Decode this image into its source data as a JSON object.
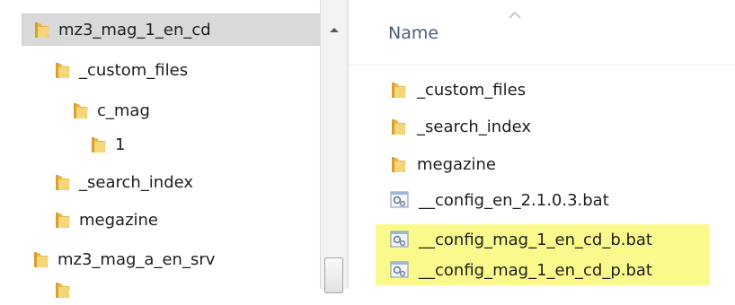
{
  "navigation_pane": {
    "items": [
      {
        "label": "mz3_mag_1_en_cd",
        "icon": "folder-icon",
        "selected": true
      },
      {
        "label": "_custom_files",
        "icon": "folder-icon"
      },
      {
        "label": "c_mag",
        "icon": "folder-icon"
      },
      {
        "label": "1",
        "icon": "folder-icon"
      },
      {
        "label": "_search_index",
        "icon": "folder-icon"
      },
      {
        "label": "megazine",
        "icon": "folder-icon"
      },
      {
        "label": "mz3_mag_a_en_srv",
        "icon": "folder-icon"
      },
      {
        "label": "",
        "icon": "folder-icon"
      }
    ],
    "scrollbar": {
      "up_icon": "scroll-up-arrow-icon"
    }
  },
  "file_list": {
    "column_header": {
      "name_label": "Name",
      "sort_icon": "sort-ascending-icon"
    },
    "rows": [
      {
        "label": "_custom_files",
        "type": "folder",
        "highlighted": false
      },
      {
        "label": "_search_index",
        "type": "folder",
        "highlighted": false
      },
      {
        "label": "megazine",
        "type": "folder",
        "highlighted": false
      },
      {
        "label": "__config_en_2.1.0.3.bat",
        "type": "batch",
        "highlighted": false
      },
      {
        "label": "__config_mag_1_en_cd_b.bat",
        "type": "batch",
        "highlighted": true
      },
      {
        "label": "__config_mag_1_en_cd_p.bat",
        "type": "batch",
        "highlighted": true
      }
    ]
  },
  "colors": {
    "folder_body": "#e8b84a",
    "folder_front": "#f6d67a",
    "selection_bg": "#d9d9d9",
    "highlight": "#fafa8c",
    "header_text": "#4c607a"
  }
}
